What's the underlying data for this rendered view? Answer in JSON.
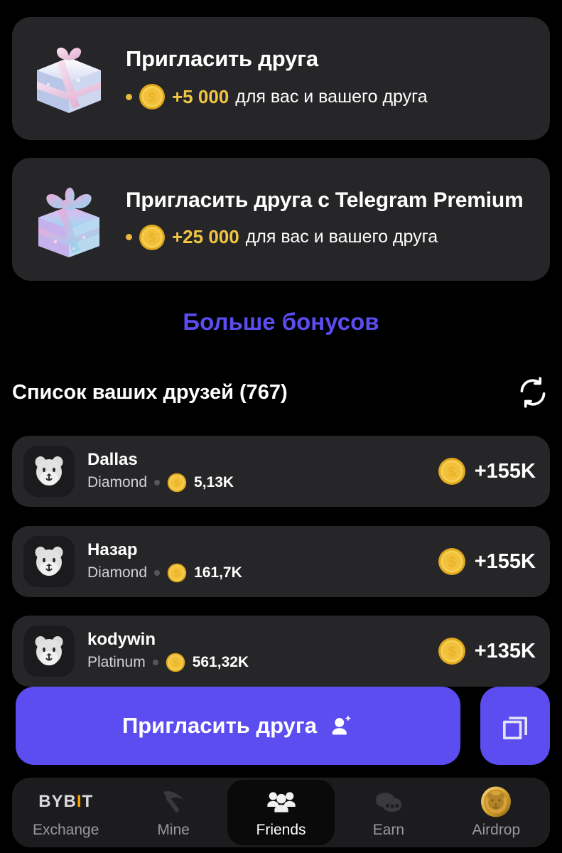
{
  "bonus_cards": [
    {
      "id": "invite-friend",
      "icon": "gift-box-icon",
      "title": "Пригласить друга",
      "coin_icon": "coin-dollar-icon",
      "amount": "+5 000",
      "description": "для вас и вашего друга"
    },
    {
      "id": "invite-friend-premium",
      "icon": "gift-box-premium-icon",
      "title": "Пригласить друга с Telegram Premium",
      "coin_icon": "coin-dollar-icon",
      "amount": "+25 000",
      "description": "для вас и вашего друга"
    }
  ],
  "more_bonuses_label": "Больше бонусов",
  "friends_section": {
    "title": "Список ваших друзей (767)",
    "count": 767,
    "refresh_icon": "refresh-icon",
    "rows": [
      {
        "avatar": "hamster-avatar-icon",
        "name": "Dallas",
        "level": "Diamond",
        "balance": "5,13K",
        "reward": "+155K"
      },
      {
        "avatar": "hamster-avatar-icon",
        "name": "Назар",
        "level": "Diamond",
        "balance": "161,7K",
        "reward": "+155K"
      },
      {
        "avatar": "hamster-avatar-icon",
        "name": "kodywin",
        "level": "Platinum",
        "balance": "561,32K",
        "reward": "+135K"
      }
    ]
  },
  "invite_button": {
    "label": "Пригласить друга",
    "icon": "add-person-icon"
  },
  "copy_button": {
    "icon": "copy-icon"
  },
  "bottom_nav": {
    "items": [
      {
        "id": "exchange",
        "label": "Exchange",
        "icon": "bybit-logo-icon",
        "active": false
      },
      {
        "id": "mine",
        "label": "Mine",
        "icon": "pickaxe-icon",
        "active": false
      },
      {
        "id": "friends",
        "label": "Friends",
        "icon": "friends-icon",
        "active": true
      },
      {
        "id": "earn",
        "label": "Earn",
        "icon": "coins-stack-icon",
        "active": false
      },
      {
        "id": "airdrop",
        "label": "Airdrop",
        "icon": "hamster-coin-icon",
        "active": false
      }
    ]
  },
  "colors": {
    "background": "#000000",
    "card": "#262628",
    "accent": "#5b4df0",
    "coin_gold": "#f2c644",
    "text": "#ffffff",
    "muted": "#9a9a9d",
    "bybit_orange": "#f7a600"
  }
}
